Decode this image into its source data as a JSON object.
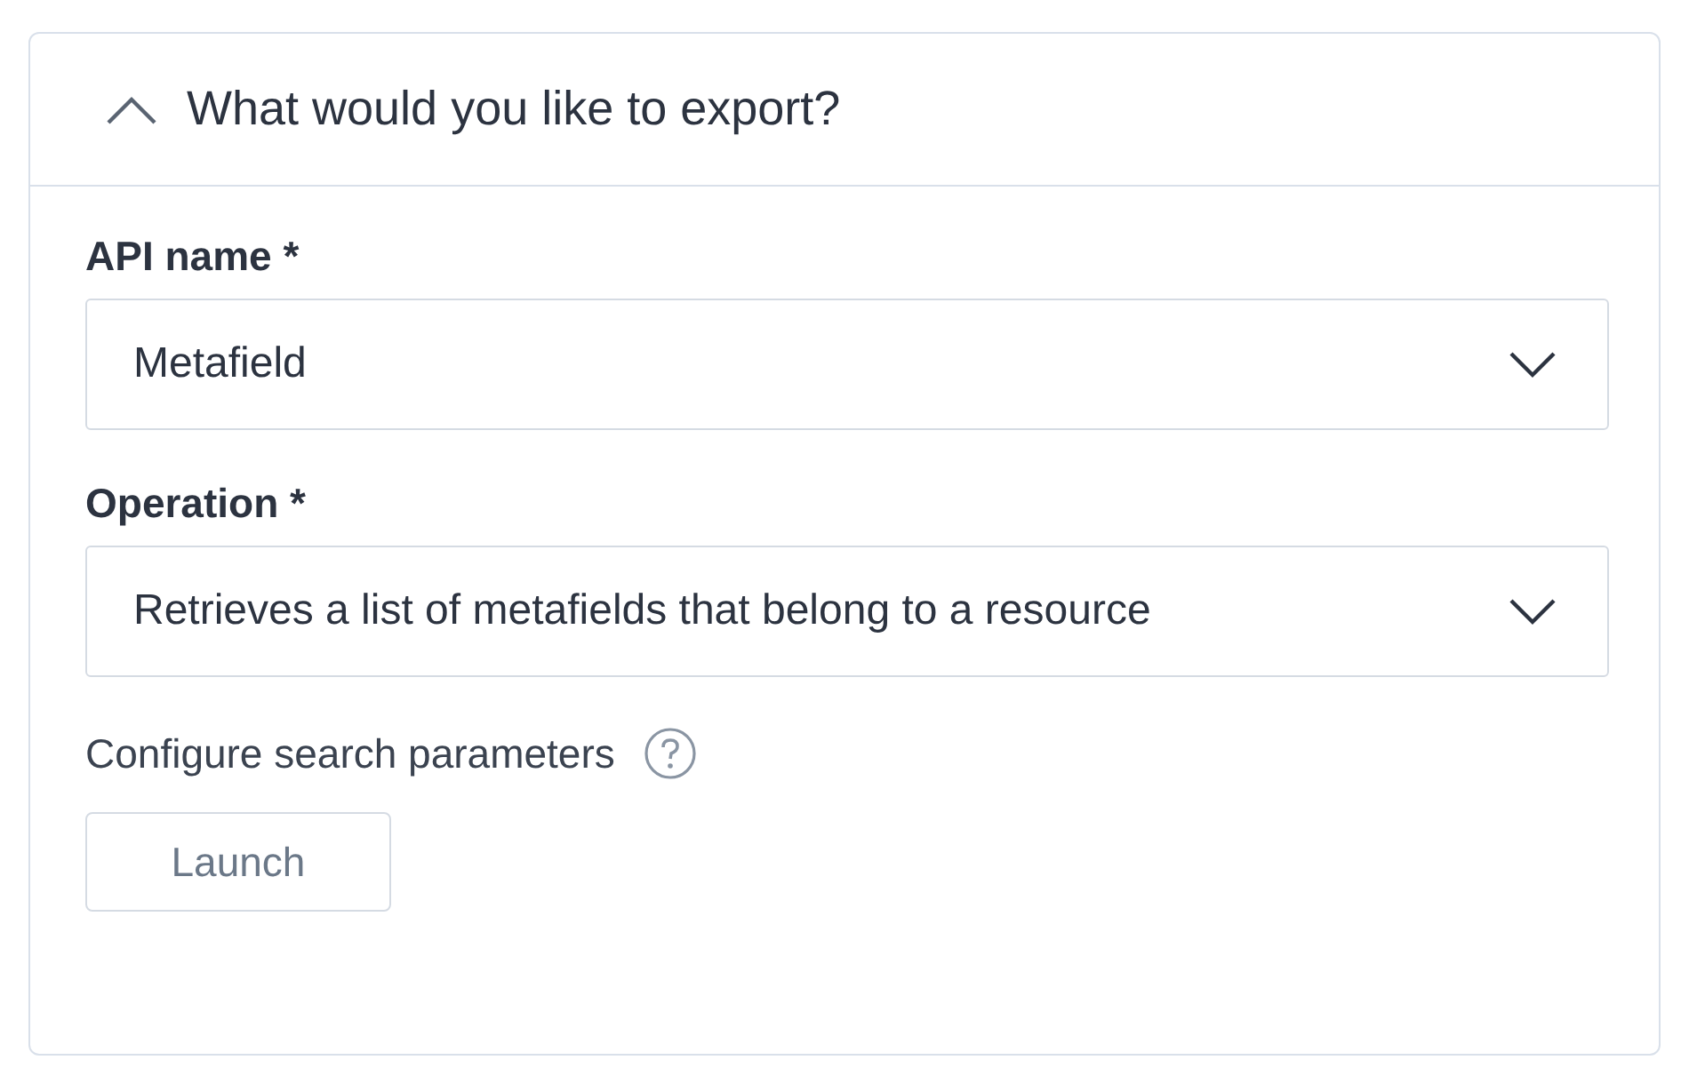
{
  "panel": {
    "title": "What would you like to export?",
    "expanded": true
  },
  "fields": [
    {
      "label": "API name *",
      "value": "Metafield"
    },
    {
      "label": "Operation *",
      "value": "Retrieves a list of metafields that belong to a resource"
    }
  ],
  "search_parameters": {
    "label": "Configure search parameters"
  },
  "buttons": [
    {
      "label": "Launch"
    }
  ]
}
